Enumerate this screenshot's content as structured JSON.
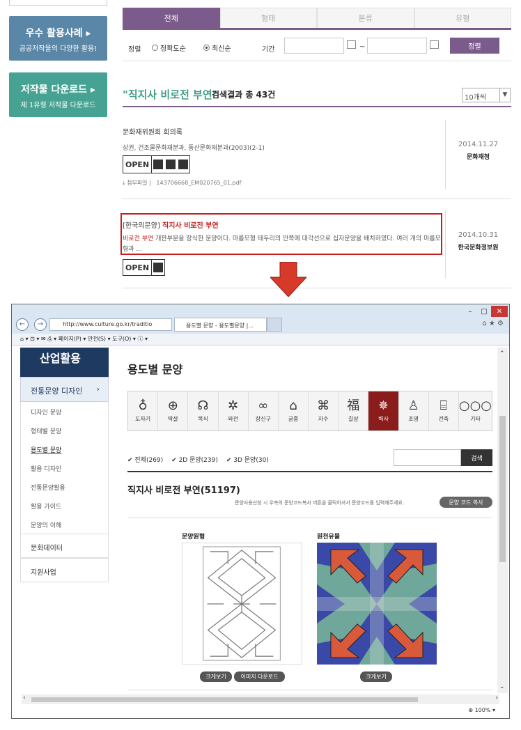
{
  "left_banners": {
    "banner1_title": "우수 활용사례 ▸",
    "banner1_sub": "공공저작물의 다양한 활용!",
    "banner2_title": "저작물 다운로드 ▸",
    "banner2_sub": "제 1유형 저작물 다운로드"
  },
  "tabs": [
    "전체",
    "형태",
    "분류",
    "유형"
  ],
  "filter": {
    "sort_label": "정렬",
    "option1": "정확도순",
    "option2": "최신순",
    "period_label": "기간",
    "tilde": "~",
    "sort_button": "정렬"
  },
  "search_heading": {
    "keyword": "\"직지사 비로전 부연\"",
    "count_text": "검색결과 총 43건",
    "per_page": "10개씩"
  },
  "results": [
    {
      "title": "문화재위원회 회의록",
      "desc": "상권, 건조물문화재분과, 동산문화재분과(2003)(2-1)",
      "license": "OPEN",
      "attach_label": "첨부파일 |",
      "attach_file": "143706668_EM020765_01.pdf",
      "date": "2014.11.27",
      "org": "문화재청"
    },
    {
      "title_prefix": "[한국의문양]",
      "title_highlight": "직지사 비로전 부연",
      "desc_highlight": "비로전 부연",
      "desc": " 개판부분을 장식한 문양이다. 마름모형 테두리의 안쪽에 대각선으로 십자문양을 배치하였다. 여러 개의 마름모형과 ...",
      "license": "OPEN",
      "date": "2014.10.31",
      "org": "한국문화정보원"
    }
  ],
  "browser": {
    "address": "http://www.culture.go.kr/traditio",
    "tab_title": "용도별 문양 - 용도별문양 |...",
    "cmdbar": "페이지(P) ▾  안전(S) ▾  도구(O) ▾",
    "zoom": "100%"
  },
  "inner": {
    "nav_header": "산업활용",
    "nav_selected": "전통문양 디자인",
    "nav_subs": [
      "디자인 문양",
      "형태별 문양",
      "용도별 문양",
      "활용 디자인",
      "전통문양활용",
      "활용 가이드",
      "문양의 이해"
    ],
    "nav_mains": [
      "문화데이터",
      "지원사업"
    ],
    "page_title": "용도별 문양",
    "categories": [
      {
        "label": "도자기",
        "icon": "♁"
      },
      {
        "label": "딱살",
        "icon": "⊕"
      },
      {
        "label": "복식",
        "icon": "☊"
      },
      {
        "label": "와전",
        "icon": "✲"
      },
      {
        "label": "장신구",
        "icon": "∞"
      },
      {
        "label": "궁중",
        "icon": "⌂"
      },
      {
        "label": "자수",
        "icon": "⌘"
      },
      {
        "label": "길상",
        "icon": "福"
      },
      {
        "label": "벽사",
        "icon": "✵"
      },
      {
        "label": "조명",
        "icon": "♙"
      },
      {
        "label": "건축",
        "icon": "⌸"
      },
      {
        "label": "기타",
        "icon": "○○○"
      }
    ],
    "filter_all": "✔ 전체(269)",
    "filter_2d": "✔ 2D 문양(239)",
    "filter_3d": "✔ 3D 문양(30)",
    "search_btn": "검색",
    "pattern_title": "직지사 비로전 부연(51197)",
    "copy_info": "문양사용신청 시 우측의 문양코드복사 버튼을 클릭하셔서 문양코드를 입력해주세요.",
    "copy_btn": "문양 코드 복사",
    "label_original": "문양원형",
    "label_source": "원천유물",
    "btn_zoom1": "크게보기",
    "btn_download": "이미지 다운로드",
    "btn_zoom2": "크게보기"
  },
  "colors": {
    "accent_purple": "#7a5b8c",
    "highlight_red": "#c81e1e",
    "keyword_green": "#3f9e86",
    "nav_dark": "#1f3a60",
    "active_cat": "#8a1c1c"
  }
}
